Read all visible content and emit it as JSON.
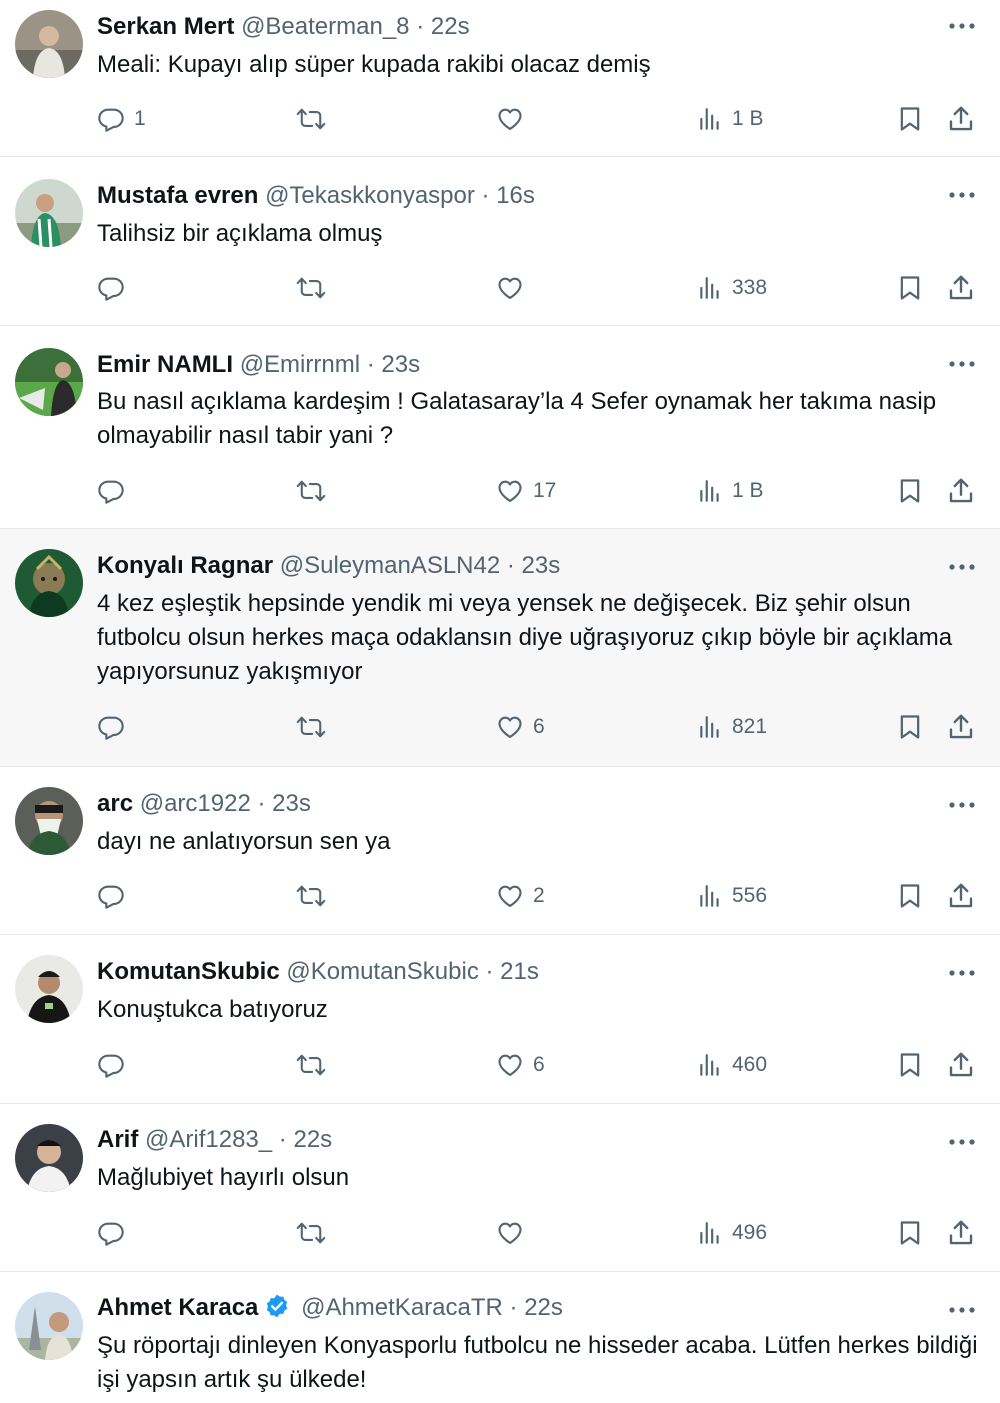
{
  "tweets": [
    {
      "name": "Serkan Mert",
      "handle": "@Beaterman_8",
      "sep": "·",
      "time": "22s",
      "text": "Meali: Kupayı alıp süper kupada rakibi olacaz demiş",
      "replies": "1",
      "retweets": "",
      "likes": "",
      "views": "1 B",
      "verified": false
    },
    {
      "name": "Mustafa evren",
      "handle": "@Tekaskkonyaspor",
      "sep": "·",
      "time": "16s",
      "text": "Talihsiz bir açıklama olmuş",
      "replies": "",
      "retweets": "",
      "likes": "",
      "views": "338",
      "verified": false
    },
    {
      "name": "Emir NAMLI",
      "handle": "@Emirrnml",
      "sep": "·",
      "time": "23s",
      "text": "Bu nasıl açıklama kardeşim ! Galatasaray’la 4 Sefer oynamak her takıma nasip olmayabilir nasıl  tabir yani ?",
      "replies": "",
      "retweets": "",
      "likes": "17",
      "views": "1 B",
      "verified": false
    },
    {
      "name": "Konyalı Ragnar",
      "handle": "@SuleymanASLN42",
      "sep": "·",
      "time": "23s",
      "text": "4 kez eşleştik hepsinde yendik mi veya yensek ne değişecek. Biz şehir olsun futbolcu olsun herkes maça odaklansın diye uğraşıyoruz çıkıp böyle bir açıklama yapıyorsunuz yakışmıyor",
      "replies": "",
      "retweets": "",
      "likes": "6",
      "views": "821",
      "verified": false
    },
    {
      "name": "arc",
      "handle": "@arc1922",
      "sep": "·",
      "time": "23s",
      "text": "dayı ne anlatıyorsun sen ya",
      "replies": "",
      "retweets": "",
      "likes": "2",
      "views": "556",
      "verified": false
    },
    {
      "name": "KomutanSkubic",
      "handle": "@KomutanSkubic",
      "sep": "·",
      "time": "21s",
      "text": "Konuştukca  batıyoruz",
      "replies": "",
      "retweets": "",
      "likes": "6",
      "views": "460",
      "verified": false
    },
    {
      "name": "Arif",
      "handle": "@Arif1283_",
      "sep": "·",
      "time": "22s",
      "text": "Mağlubiyet hayırlı olsun",
      "replies": "",
      "retweets": "",
      "likes": "",
      "views": "496",
      "verified": false
    },
    {
      "name": "Ahmet Karaca",
      "handle": "@AhmetKaracaTR",
      "sep": "·",
      "time": "22s",
      "text": "Şu röportajı dinleyen Konyasporlu futbolcu ne hisseder acaba. Lütfen herkes bildiği işi yapsın artık şu ülkede!",
      "replies": "",
      "retweets": "",
      "likes": "",
      "views": "",
      "verified": true
    }
  ],
  "icons": {
    "reply": "reply-icon",
    "retweet": "retweet-icon",
    "like": "heart-icon",
    "views": "views-icon",
    "bookmark": "bookmark-icon",
    "share": "share-icon",
    "more": "more-icon",
    "verified": "verified-badge-icon"
  },
  "colors": {
    "text": "#0f1419",
    "secondary": "#536471",
    "divider": "#e7e9ea",
    "highlight_bg": "#f7f7f7",
    "verified": "#1d9bf0"
  }
}
